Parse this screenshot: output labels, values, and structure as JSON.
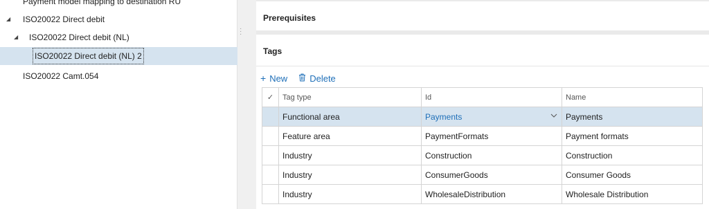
{
  "tree": {
    "items": [
      {
        "label": "Payment model mapping to destination RU",
        "caret": ""
      },
      {
        "label": "ISO20022 Direct debit",
        "caret": "◢"
      },
      {
        "label": "ISO20022 Direct debit (NL)",
        "caret": "◢"
      },
      {
        "label": "ISO20022 Direct debit (NL) 2",
        "caret": ""
      },
      {
        "label": "ISO20022 Camt.054",
        "caret": ""
      }
    ]
  },
  "prerequisites": {
    "title": "Prerequisites"
  },
  "tags": {
    "title": "Tags",
    "toolbar": {
      "new_label": "New",
      "delete_label": "Delete",
      "new_icon": "plus-icon",
      "delete_icon": "trash-icon"
    },
    "grid": {
      "columns": [
        "Tag type",
        "Id",
        "Name"
      ],
      "check_glyph": "✓",
      "rows": [
        {
          "tag_type": "Functional area",
          "id": "Payments",
          "name": "Payments"
        },
        {
          "tag_type": "Feature area",
          "id": "PaymentFormats",
          "name": "Payment formats"
        },
        {
          "tag_type": "Industry",
          "id": "Construction",
          "name": "Construction"
        },
        {
          "tag_type": "Industry",
          "id": "ConsumerGoods",
          "name": "Consumer Goods"
        },
        {
          "tag_type": "Industry",
          "id": "WholesaleDistribution",
          "name": "Wholesale Distribution"
        }
      ]
    }
  },
  "colors": {
    "accent": "#1e6fb8",
    "selection": "#d5e3ef"
  }
}
